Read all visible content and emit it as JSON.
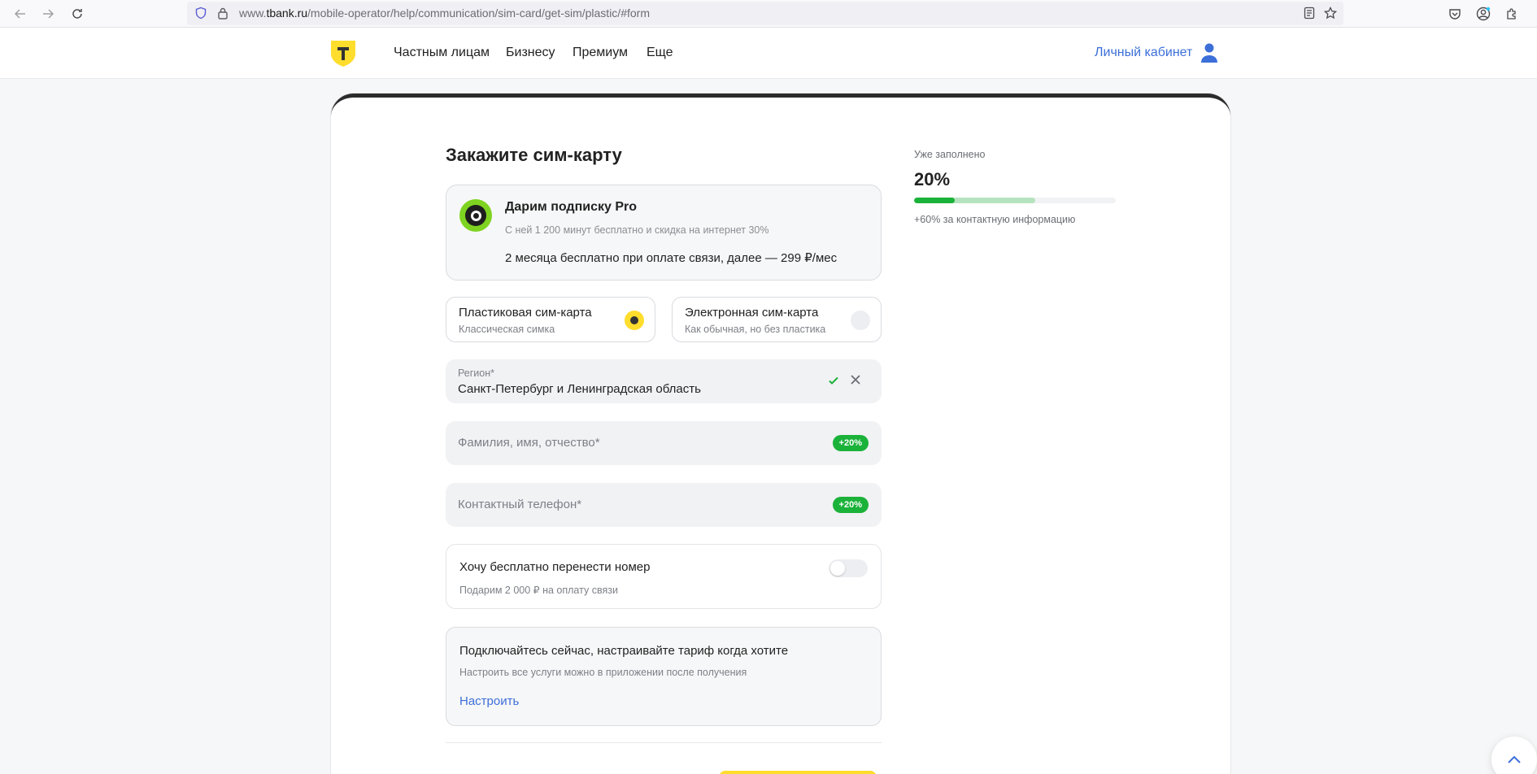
{
  "browser": {
    "url_prefix": "www.",
    "url_domain": "tbank.ru",
    "url_path": "/mobile-operator/help/communication/sim-card/get-sim/plastic/#form"
  },
  "header": {
    "nav": [
      "Частным лицам",
      "Бизнесу",
      "Премиум",
      "Еще"
    ],
    "cabinet": "Личный кабинет"
  },
  "form": {
    "title": "Закажите сим-карту",
    "promo": {
      "title": "Дарим подписку Pro",
      "subtitle": "С ней 1 200 минут бесплатно и скидка на интернет 30%",
      "price": "2 месяца бесплатно при оплате связи, далее — 299 ₽/мес"
    },
    "sim_options": [
      {
        "title": "Пластиковая сим-карта",
        "subtitle": "Классическая симка",
        "selected": true
      },
      {
        "title": "Электронная сим-карта",
        "subtitle": "Как обычная, но без пластика",
        "selected": false
      }
    ],
    "region": {
      "label": "Регион*",
      "value": "Санкт-Петербург и Ленинградская область"
    },
    "name_field": {
      "placeholder": "Фамилия, имя, отчество*",
      "badge": "+20%"
    },
    "phone_field": {
      "placeholder": "Контактный телефон*",
      "badge": "+20%"
    },
    "port_number": {
      "title": "Хочу бесплатно перенести номер",
      "subtitle": "Подарим 2 000 ₽ на оплату связи",
      "enabled": false
    },
    "info": {
      "title": "Подключайтесь сейчас, настраивайте тариф когда хотите",
      "subtitle": "Настроить все услуги можно в приложении после получения",
      "link": "Настроить"
    }
  },
  "progress": {
    "label": "Уже заполнено",
    "value_text": "20%",
    "filled_fraction": 0.2,
    "potential_fraction": 0.6,
    "hint": "+60% за контактную информацию"
  },
  "colors": {
    "accent_yellow": "#ffdd2d",
    "link_blue": "#3c6fd8",
    "success_green": "#1bb23a",
    "promo_green": "#7ed321"
  },
  "icons": [
    "back-icon",
    "forward-icon",
    "reload-icon",
    "shield-icon",
    "lock-icon",
    "reader-icon",
    "star-icon",
    "pocket-icon",
    "account-icon",
    "extensions-icon",
    "logo-icon",
    "user-icon",
    "check-icon",
    "clear-icon",
    "chevron-up-icon"
  ]
}
